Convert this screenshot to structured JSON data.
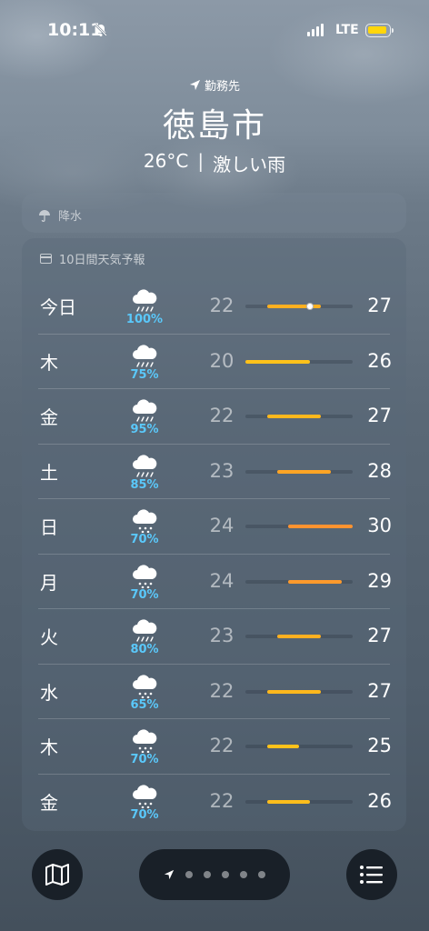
{
  "status_bar": {
    "time": "10:11",
    "network": "LTE",
    "battery_color": "#ffd60a"
  },
  "header": {
    "location_label": "勤務先",
    "city": "徳島市",
    "temperature": "26°C",
    "condition": "激しい雨"
  },
  "precipitation_card": {
    "label": "降水"
  },
  "forecast": {
    "title": "10日間天気予報",
    "scale_min": 20,
    "scale_max": 30,
    "current_temp": 26,
    "days": [
      {
        "day": "今日",
        "icon": "heavy-rain-icon",
        "chance": "100%",
        "low": 22,
        "high": 27,
        "bar_color": "#ffb020"
      },
      {
        "day": "木",
        "icon": "heavy-rain-icon",
        "chance": "75%",
        "low": 20,
        "high": 26,
        "bar_color": "#ffc21a"
      },
      {
        "day": "金",
        "icon": "heavy-rain-icon",
        "chance": "95%",
        "low": 22,
        "high": 27,
        "bar_color": "#ffb81c"
      },
      {
        "day": "土",
        "icon": "heavy-rain-icon",
        "chance": "85%",
        "low": 23,
        "high": 28,
        "bar_color": "#ffa524"
      },
      {
        "day": "日",
        "icon": "rain-icon",
        "chance": "70%",
        "low": 24,
        "high": 30,
        "bar_color": "#ff9330"
      },
      {
        "day": "月",
        "icon": "rain-icon",
        "chance": "70%",
        "low": 24,
        "high": 29,
        "bar_color": "#ff9a2c"
      },
      {
        "day": "火",
        "icon": "heavy-rain-icon",
        "chance": "80%",
        "low": 23,
        "high": 27,
        "bar_color": "#ffb020"
      },
      {
        "day": "水",
        "icon": "rain-icon",
        "chance": "65%",
        "low": 22,
        "high": 27,
        "bar_color": "#ffb81c"
      },
      {
        "day": "木",
        "icon": "rain-icon",
        "chance": "70%",
        "low": 22,
        "high": 25,
        "bar_color": "#ffc21a"
      },
      {
        "day": "金",
        "icon": "rain-icon",
        "chance": "70%",
        "low": 22,
        "high": 26,
        "bar_color": "#ffbe1c"
      }
    ]
  },
  "bottom_bar": {
    "left_icon": "map-icon",
    "right_icon": "list-icon",
    "page_count": 5
  }
}
